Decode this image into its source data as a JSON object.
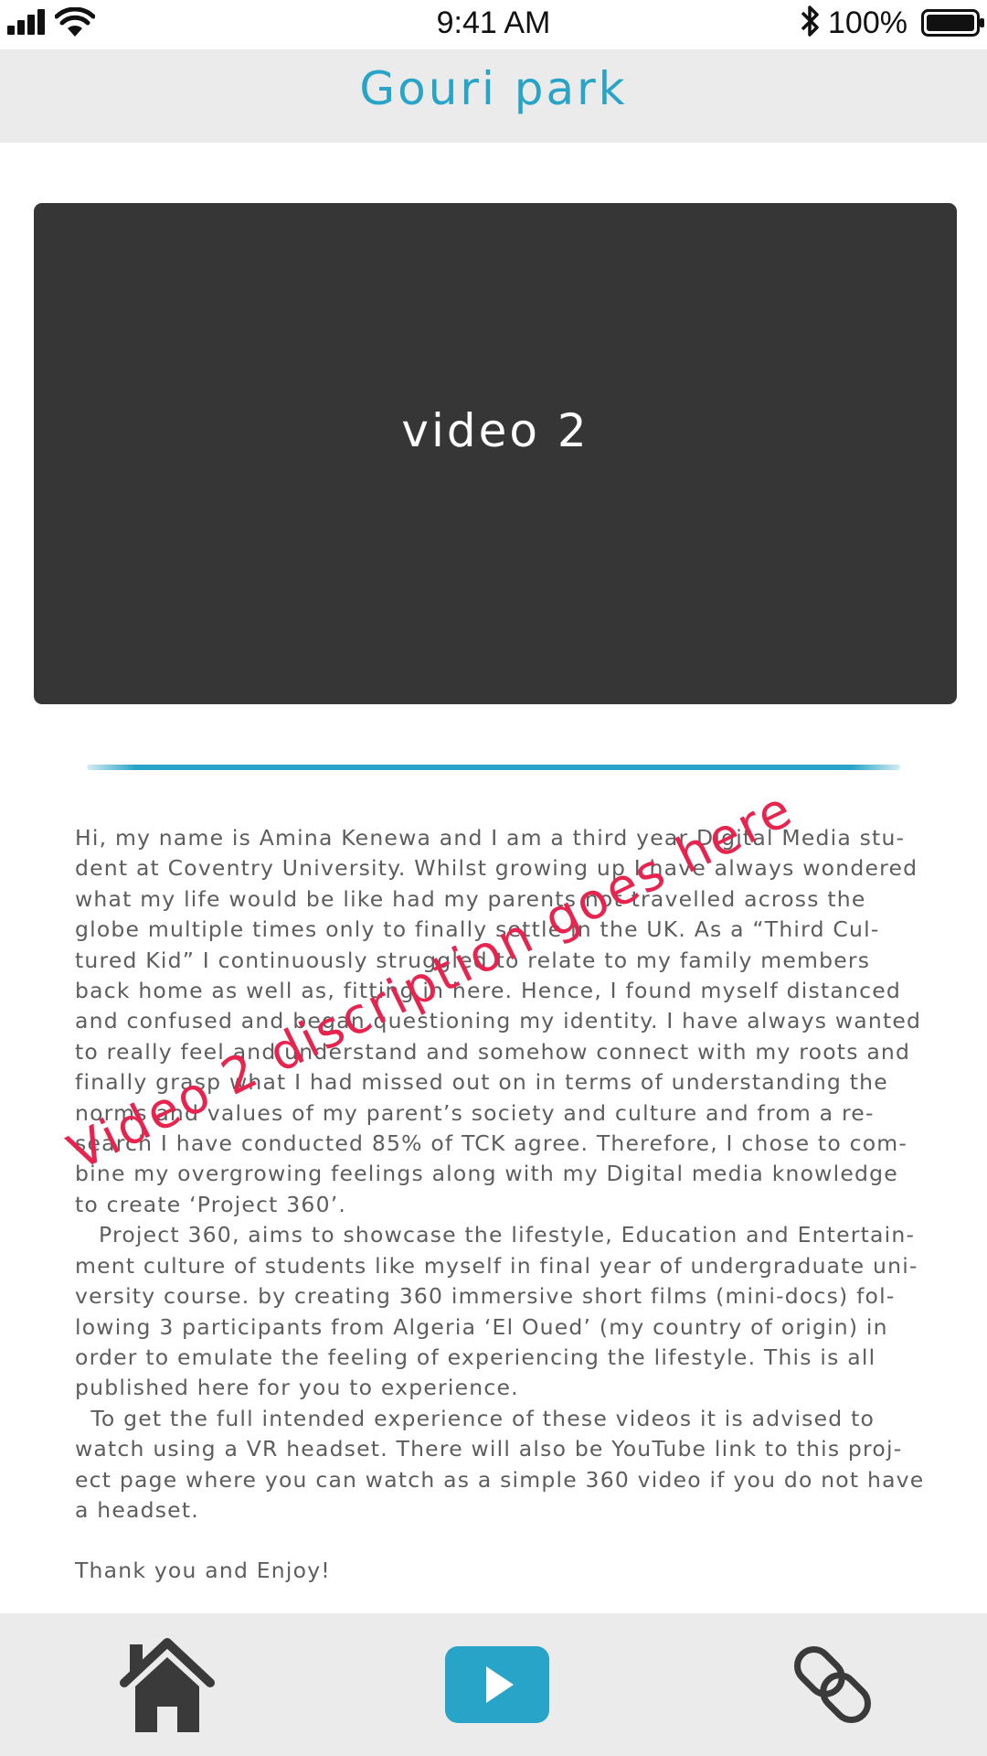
{
  "status_bar": {
    "time": "9:41 AM",
    "battery": "100%",
    "icons": [
      "signal-icon",
      "wifi-icon",
      "bluetooth-icon",
      "battery-icon"
    ]
  },
  "header": {
    "title": "Gouri park"
  },
  "video": {
    "label": "video 2"
  },
  "description": {
    "paragraphs": [
      "Hi, my name is Amina Kenewa and I am a third year Digital Media stu-\ndent at Coventry University. Whilst growing up I have always wondered\nwhat my life would be like had my parents not travelled across the\nglobe multiple times only to finally settle in the UK. As a “Third Cul-\ntured Kid” I continuously struggled to relate to my family members\nback home as well as, fitting in here. Hence, I found myself distanced\nand confused and began questioning my identity. I have always wanted\nto really feel and understand and somehow connect with my roots and\nfinally grasp what I had missed out on in terms of understanding the\nnorms and values of my parent’s society and culture and from a re-\nsearch I have conducted 85% of TCK agree. Therefore, I chose to com-\nbine my overgrowing feelings along with my Digital media knowledge\nto create ‘Project 360’.",
      "   Project 360, aims to showcase the lifestyle, Education and Entertain-\nment culture of students like myself in final year of undergraduate uni-\nversity course. by creating 360 immersive short films (mini-docs) fol-\nlowing 3 participants from Algeria ‘El Oued’ (my country of origin) in\norder to emulate the feeling of experiencing the lifestyle. This is all\npublished here for you to experience.",
      "  To get the full intended experience of these videos it is advised to\nwatch using a VR headset. There will also be YouTube link to this proj-\nect page where you can watch as a simple 360 video if you do not have\na headset."
    ],
    "closing": "Thank you and Enjoy!"
  },
  "annotation": {
    "text": "Video 2 discription goes here",
    "color": "#e8244e"
  },
  "bottom_nav": {
    "items": [
      {
        "icon": "home-icon",
        "active": false
      },
      {
        "icon": "play-icon",
        "active": true
      },
      {
        "icon": "link-icon",
        "active": false
      }
    ]
  },
  "colors": {
    "accent": "#27a4c7",
    "video_bg": "#363636",
    "bar_bg": "#ebebeb",
    "text": "#5d5d5d"
  }
}
